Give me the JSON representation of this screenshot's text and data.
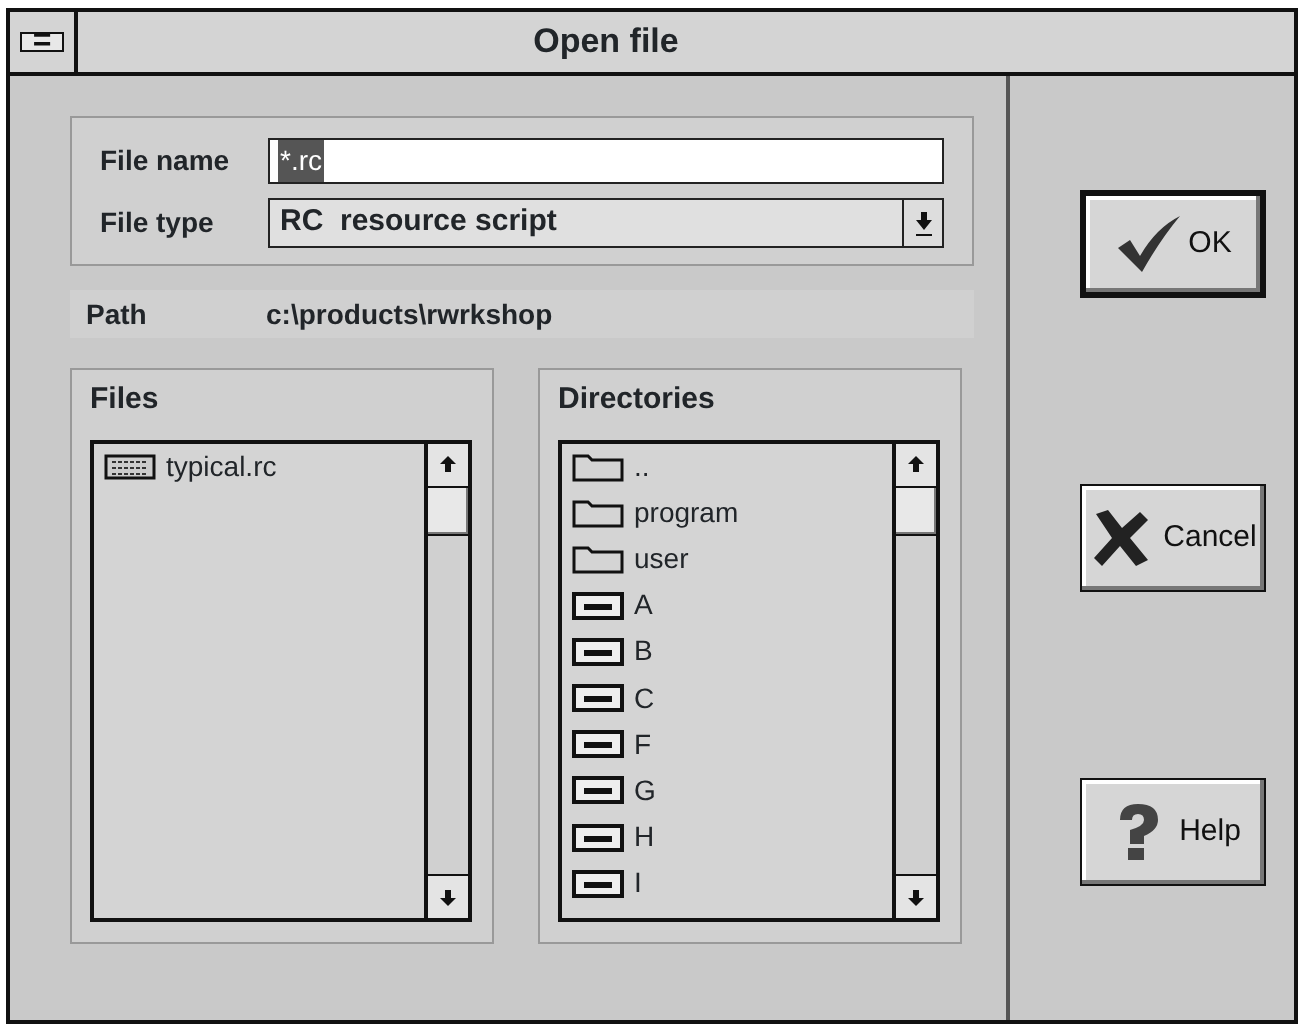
{
  "window": {
    "title": "Open file",
    "menu_glyph": "="
  },
  "file_name": {
    "label": "File name",
    "value": "*.rc",
    "value_selected": true
  },
  "file_type": {
    "label": "File type",
    "value": "RC  resource script"
  },
  "path": {
    "label": "Path",
    "value": "c:\\products\\rwrkshop"
  },
  "files": {
    "label": "Files",
    "items": [
      {
        "name": "typical.rc",
        "kind": "file"
      }
    ]
  },
  "directories": {
    "label": "Directories",
    "items": [
      {
        "name": "..",
        "kind": "folder"
      },
      {
        "name": "program",
        "kind": "folder"
      },
      {
        "name": "user",
        "kind": "folder"
      },
      {
        "name": "A",
        "kind": "drive"
      },
      {
        "name": "B",
        "kind": "drive"
      },
      {
        "name": "C",
        "kind": "drive"
      },
      {
        "name": "F",
        "kind": "drive"
      },
      {
        "name": "G",
        "kind": "drive"
      },
      {
        "name": "H",
        "kind": "drive"
      },
      {
        "name": "I",
        "kind": "drive"
      }
    ]
  },
  "buttons": [
    {
      "label": "OK",
      "kind": "ok",
      "default": true
    },
    {
      "label": "Cancel",
      "kind": "cancel",
      "default": false
    },
    {
      "label": "Help",
      "kind": "help",
      "default": false
    }
  ]
}
